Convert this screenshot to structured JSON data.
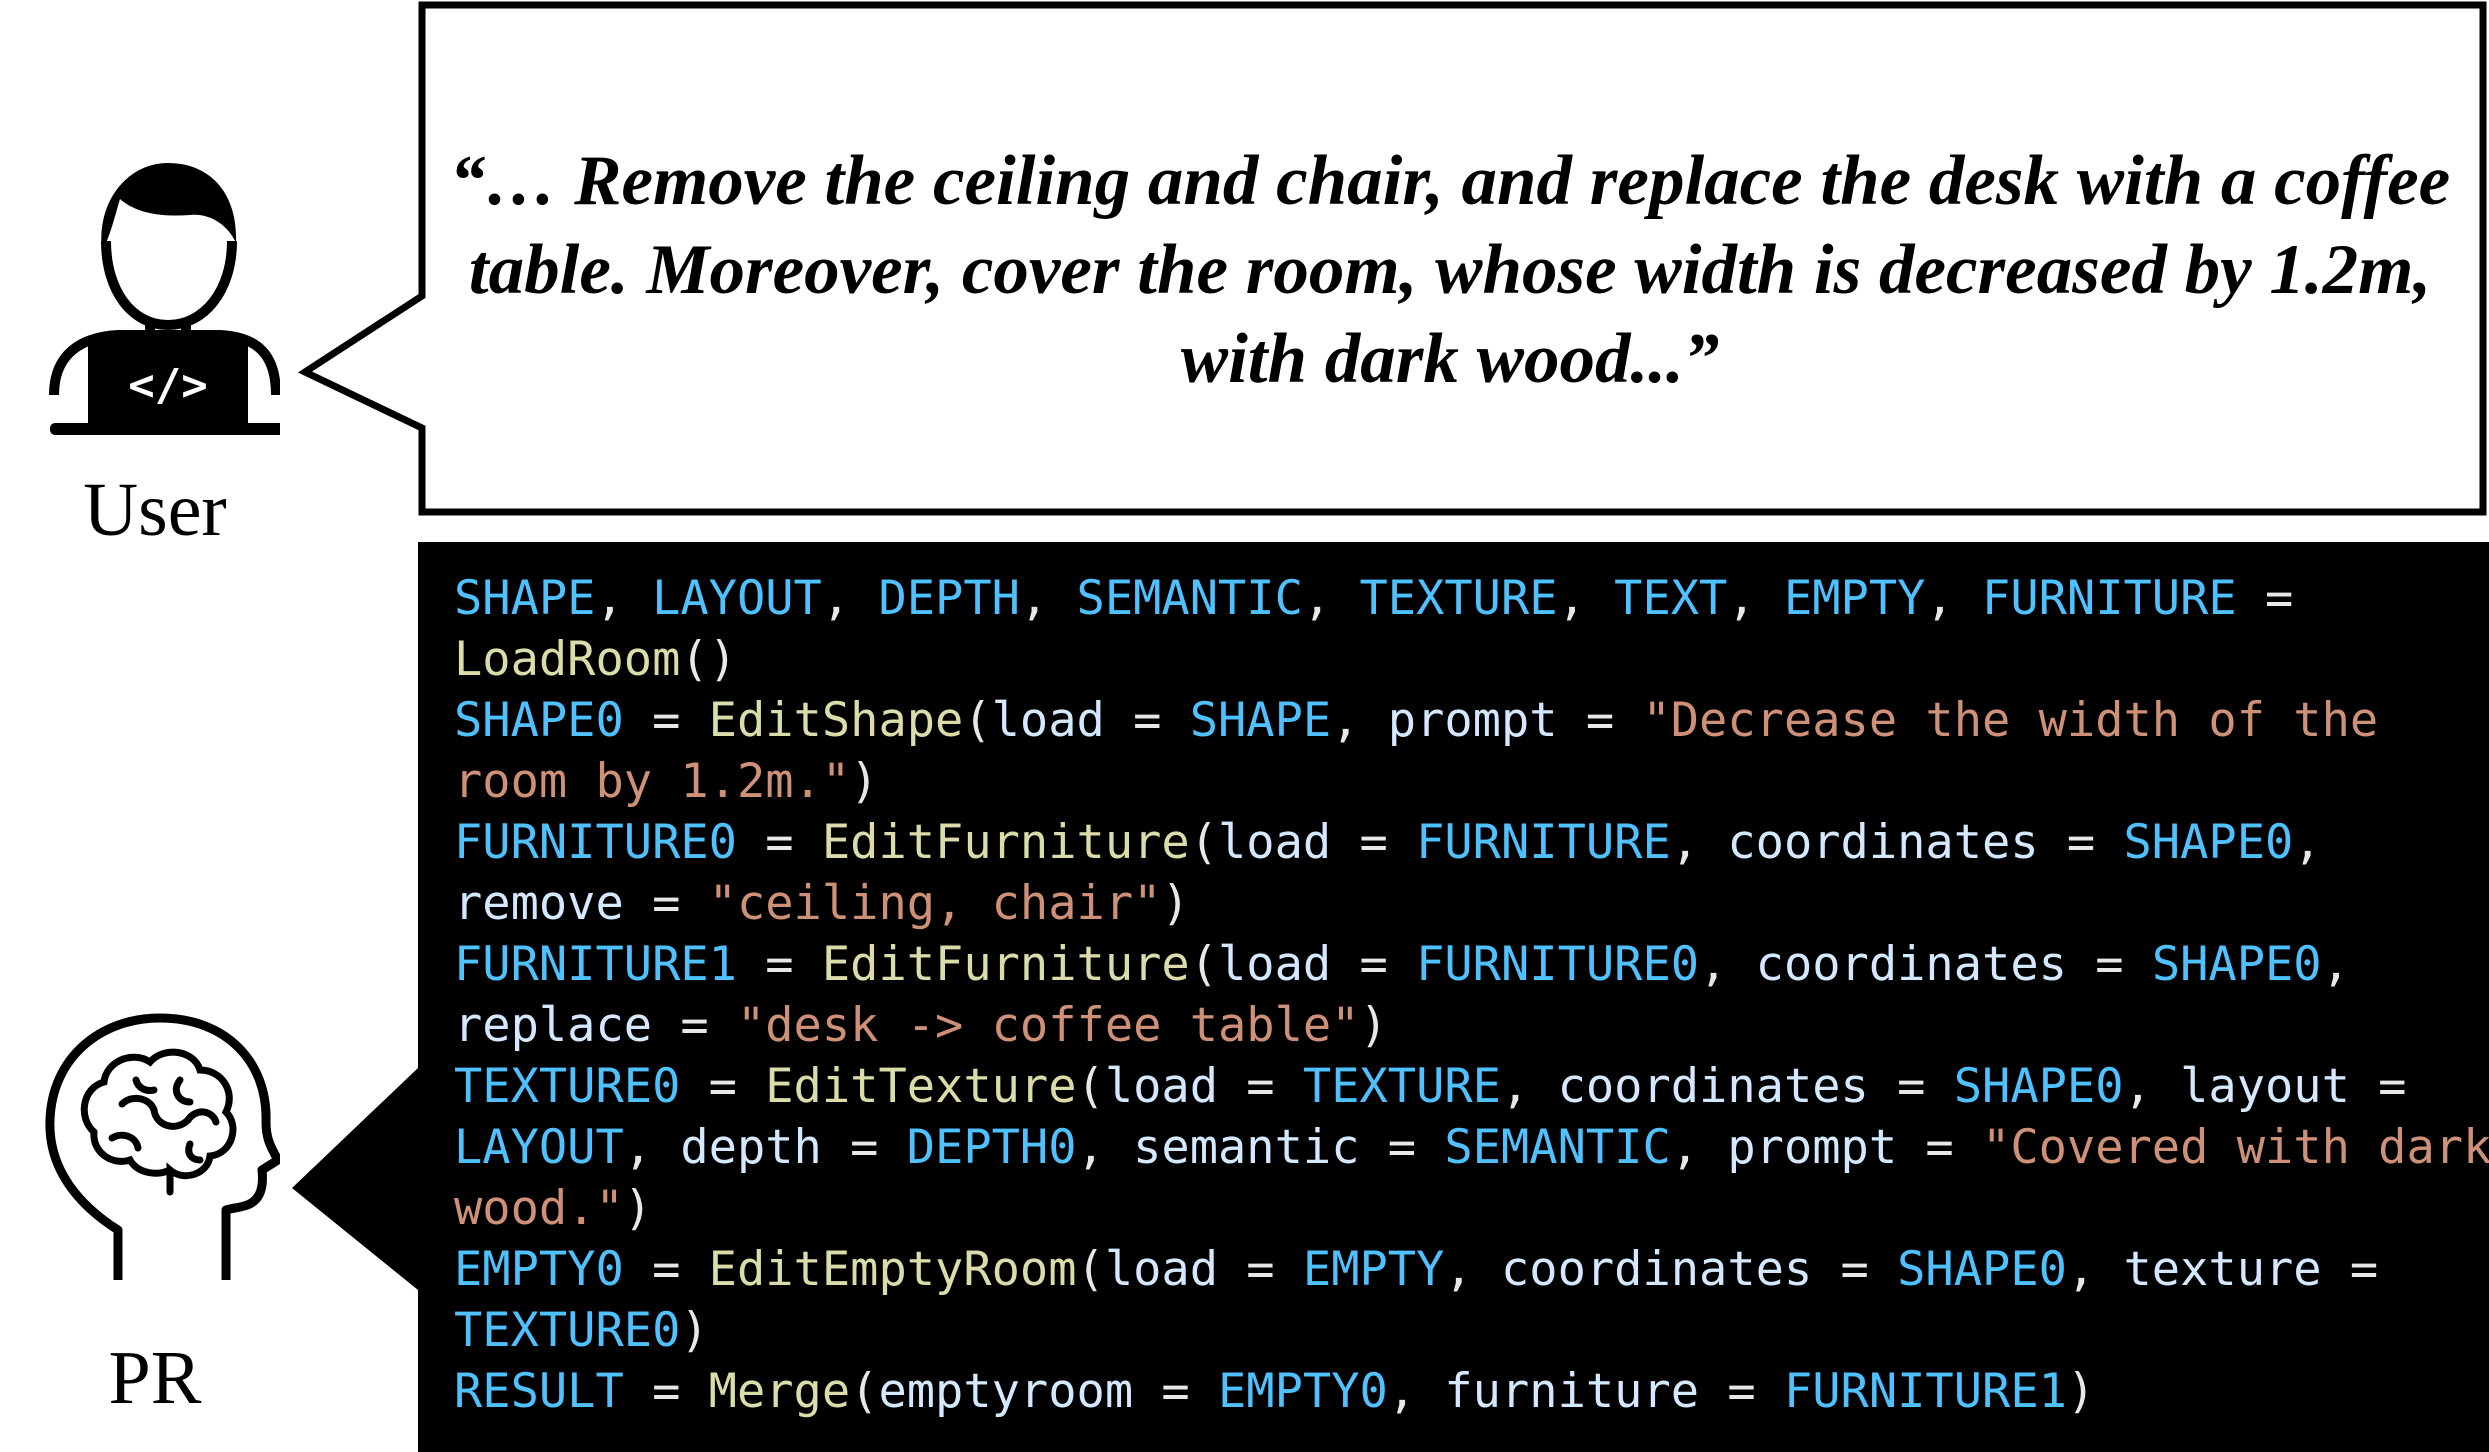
{
  "user_label": "User",
  "pr_label": "PR",
  "quote": "“… Remove the ceiling and chair, and replace the desk with a coffee table. Moreover, cover the room, whose width is decreased by 1.2m, with dark wood...”",
  "code_lines": [
    [
      [
        "var",
        "SHAPE"
      ],
      [
        "p",
        ", "
      ],
      [
        "var",
        "LAYOUT"
      ],
      [
        "p",
        ", "
      ],
      [
        "var",
        "DEPTH"
      ],
      [
        "p",
        ", "
      ],
      [
        "var",
        "SEMANTIC"
      ],
      [
        "p",
        ", "
      ],
      [
        "var",
        "TEXTURE"
      ],
      [
        "p",
        ", "
      ],
      [
        "var",
        "TEXT"
      ],
      [
        "p",
        ", "
      ],
      [
        "var",
        "EMPTY"
      ],
      [
        "p",
        ", "
      ],
      [
        "var",
        "FURNITURE"
      ],
      [
        "p",
        " ="
      ]
    ],
    [
      [
        "fn",
        "LoadRoom"
      ],
      [
        "p",
        "()"
      ]
    ],
    [
      [
        "var",
        "SHAPE0"
      ],
      [
        "p",
        " = "
      ],
      [
        "fn",
        "EditShape"
      ],
      [
        "p",
        "("
      ],
      [
        "arg",
        "load"
      ],
      [
        "p",
        " = "
      ],
      [
        "var",
        "SHAPE"
      ],
      [
        "p",
        ", "
      ],
      [
        "arg",
        "prompt"
      ],
      [
        "p",
        " = "
      ],
      [
        "str",
        "\"Decrease the width of the"
      ]
    ],
    [
      [
        "str",
        "room by 1.2m.\""
      ],
      [
        "p",
        ")"
      ]
    ],
    [
      [
        "var",
        "FURNITURE0"
      ],
      [
        "p",
        " = "
      ],
      [
        "fn",
        "EditFurniture"
      ],
      [
        "p",
        "("
      ],
      [
        "arg",
        "load"
      ],
      [
        "p",
        " = "
      ],
      [
        "var",
        "FURNITURE"
      ],
      [
        "p",
        ", "
      ],
      [
        "arg",
        "coordinates"
      ],
      [
        "p",
        " = "
      ],
      [
        "var",
        "SHAPE0"
      ],
      [
        "p",
        ","
      ]
    ],
    [
      [
        "arg",
        "remove"
      ],
      [
        "p",
        " = "
      ],
      [
        "str",
        "\"ceiling, chair\""
      ],
      [
        "p",
        ")"
      ]
    ],
    [
      [
        "var",
        "FURNITURE1"
      ],
      [
        "p",
        " = "
      ],
      [
        "fn",
        "EditFurniture"
      ],
      [
        "p",
        "("
      ],
      [
        "arg",
        "load"
      ],
      [
        "p",
        " = "
      ],
      [
        "var",
        "FURNITURE0"
      ],
      [
        "p",
        ", "
      ],
      [
        "arg",
        "coordinates"
      ],
      [
        "p",
        " = "
      ],
      [
        "var",
        "SHAPE0"
      ],
      [
        "p",
        ","
      ]
    ],
    [
      [
        "arg",
        "replace"
      ],
      [
        "p",
        " = "
      ],
      [
        "str",
        "\"desk -> coffee table\""
      ],
      [
        "p",
        ")"
      ]
    ],
    [
      [
        "var",
        "TEXTURE0"
      ],
      [
        "p",
        " = "
      ],
      [
        "fn",
        "EditTexture"
      ],
      [
        "p",
        "("
      ],
      [
        "arg",
        "load"
      ],
      [
        "p",
        " = "
      ],
      [
        "var",
        "TEXTURE"
      ],
      [
        "p",
        ", "
      ],
      [
        "arg",
        "coordinates"
      ],
      [
        "p",
        " = "
      ],
      [
        "var",
        "SHAPE0"
      ],
      [
        "p",
        ", "
      ],
      [
        "arg",
        "layout"
      ],
      [
        "p",
        " ="
      ]
    ],
    [
      [
        "var",
        "LAYOUT"
      ],
      [
        "p",
        ", "
      ],
      [
        "arg",
        "depth"
      ],
      [
        "p",
        " = "
      ],
      [
        "var",
        "DEPTH0"
      ],
      [
        "p",
        ", "
      ],
      [
        "arg",
        "semantic"
      ],
      [
        "p",
        " = "
      ],
      [
        "var",
        "SEMANTIC"
      ],
      [
        "p",
        ", "
      ],
      [
        "arg",
        "prompt"
      ],
      [
        "p",
        " = "
      ],
      [
        "str",
        "\"Covered with dark"
      ]
    ],
    [
      [
        "str",
        "wood.\""
      ],
      [
        "p",
        ")"
      ]
    ],
    [
      [
        "var",
        "EMPTY0"
      ],
      [
        "p",
        " = "
      ],
      [
        "fn",
        "EditEmptyRoom"
      ],
      [
        "p",
        "("
      ],
      [
        "arg",
        "load"
      ],
      [
        "p",
        " = "
      ],
      [
        "var",
        "EMPTY"
      ],
      [
        "p",
        ", "
      ],
      [
        "arg",
        "coordinates"
      ],
      [
        "p",
        " = "
      ],
      [
        "var",
        "SHAPE0"
      ],
      [
        "p",
        ", "
      ],
      [
        "arg",
        "texture"
      ],
      [
        "p",
        " ="
      ]
    ],
    [
      [
        "var",
        "TEXTURE0"
      ],
      [
        "p",
        ")"
      ]
    ],
    [
      [
        "var",
        "RESULT"
      ],
      [
        "p",
        " = "
      ],
      [
        "fn",
        "Merge"
      ],
      [
        "p",
        "("
      ],
      [
        "arg",
        "emptyroom"
      ],
      [
        "p",
        " = "
      ],
      [
        "var",
        "EMPTY0"
      ],
      [
        "p",
        ", "
      ],
      [
        "arg",
        "furniture"
      ],
      [
        "p",
        " = "
      ],
      [
        "var",
        "FURNITURE1"
      ],
      [
        "p",
        ")"
      ]
    ]
  ],
  "colors": {
    "variable": "#4fc1ff",
    "function": "#dcdcaa",
    "string": "#ce9178",
    "argument": "#d4e8ff",
    "punctuation": "#e8e8e8",
    "code_background": "#000000"
  },
  "icons": [
    "user-laptop-icon",
    "brain-head-icon"
  ]
}
